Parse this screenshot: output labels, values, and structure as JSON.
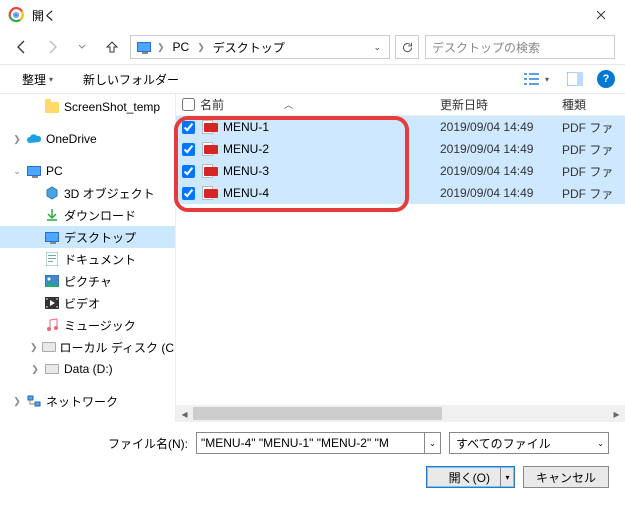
{
  "window": {
    "title": "開く"
  },
  "breadcrumb": {
    "seg1": "PC",
    "seg2": "デスクトップ"
  },
  "search": {
    "placeholder": "デスクトップの検索"
  },
  "toolbar": {
    "organize": "整理",
    "newfolder": "新しいフォルダー"
  },
  "columns": {
    "name": "名前",
    "date": "更新日時",
    "type": "種類"
  },
  "tree": {
    "screenshot": "ScreenShot_temp",
    "onedrive": "OneDrive",
    "pc": "PC",
    "items": {
      "obj3d": "3D オブジェクト",
      "downloads": "ダウンロード",
      "desktop": "デスクトップ",
      "documents": "ドキュメント",
      "pictures": "ピクチャ",
      "videos": "ビデオ",
      "music": "ミュージック",
      "localc": "ローカル ディスク (C:)",
      "datad": "Data (D:)"
    },
    "network": "ネットワーク"
  },
  "files": [
    {
      "name": "MENU-1",
      "date": "2019/09/04 14:49",
      "type": "PDF ファ"
    },
    {
      "name": "MENU-2",
      "date": "2019/09/04 14:49",
      "type": "PDF ファ"
    },
    {
      "name": "MENU-3",
      "date": "2019/09/04 14:49",
      "type": "PDF ファ"
    },
    {
      "name": "MENU-4",
      "date": "2019/09/04 14:49",
      "type": "PDF ファ"
    }
  ],
  "footer": {
    "filelabel": "ファイル名(N):",
    "filevalue": "\"MENU-4\" \"MENU-1\" \"MENU-2\" \"M",
    "filetype": "すべてのファイル",
    "open": "開く(O)",
    "cancel": "キャンセル"
  }
}
